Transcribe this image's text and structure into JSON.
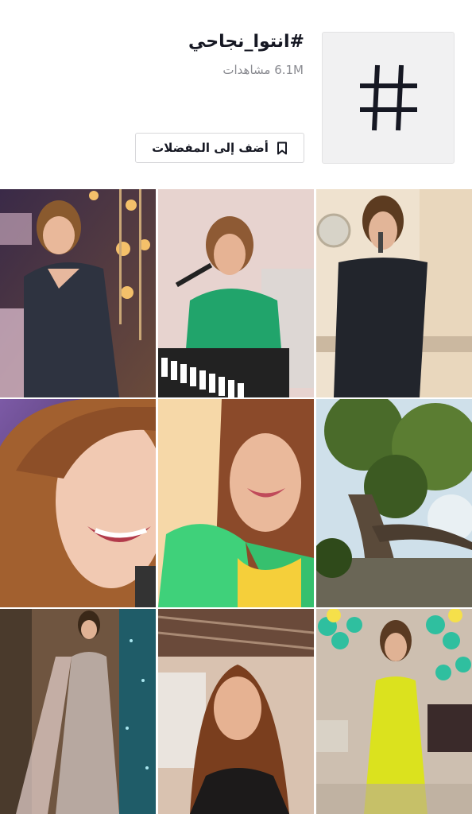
{
  "hashtag": {
    "title": "#انتوا_نجاحي",
    "views": "6.1M مشاهدات",
    "icon": "hashtag-icon",
    "favorite_button": {
      "label": "أضف إلى المفضلات",
      "icon": "bookmark-icon"
    }
  },
  "videos": [
    {
      "desc": "singer in dark satin gown with chandeliers"
    },
    {
      "desc": "singer in green blouse at keyboard with microphone"
    },
    {
      "desc": "singer in black dress holding microphone at party"
    },
    {
      "desc": "close-up smiling woman with auburn hair"
    },
    {
      "desc": "smiling woman in green blazer with lavalier mic"
    },
    {
      "desc": "tree canopy and sky"
    },
    {
      "desc": "woman in sequined gown with cape singing on stage"
    },
    {
      "desc": "woman with long hair in leather jacket outdoors"
    },
    {
      "desc": "woman in yellow dress singing at balloon party"
    }
  ],
  "colors": {
    "accent": "#161823",
    "secondary_text": "#8a8b91",
    "tile_bg": "#f1f1f2"
  }
}
